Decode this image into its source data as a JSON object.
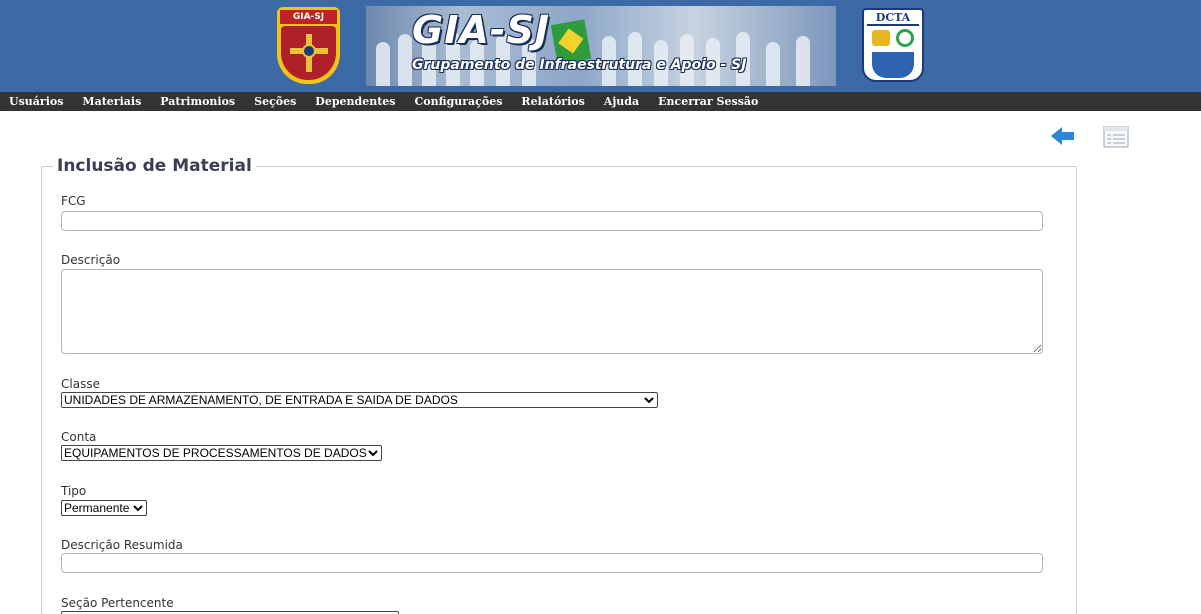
{
  "header": {
    "badge_left_text": "GIA-SJ",
    "title": "GIA-SJ",
    "subtitle": "Grupamento de Infraestrutura e Apoio - SJ",
    "badge_right_text": "DCTA",
    "colors": {
      "banner": "#3b6aa6",
      "menubar": "#333333"
    }
  },
  "menu": {
    "items": [
      "Usuários",
      "Materiais",
      "Patrimonios",
      "Seções",
      "Dependentes",
      "Configurações",
      "Relatórios",
      "Ajuda",
      "Encerrar Sessão"
    ]
  },
  "toolbar": {
    "back_icon": "arrow-left-icon",
    "list_icon": "list-icon"
  },
  "form": {
    "legend": "Inclusão de Material",
    "fcg": {
      "label": "FCG",
      "value": ""
    },
    "descricao": {
      "label": "Descrição",
      "value": ""
    },
    "classe": {
      "label": "Classe",
      "selected": "UNIDADES DE ARMAZENAMENTO, DE ENTRADA E SAIDA DE DADOS"
    },
    "conta": {
      "label": "Conta",
      "selected": "EQUIPAMENTOS DE PROCESSAMENTOS DE DADOS"
    },
    "tipo": {
      "label": "Tipo",
      "selected": "Permanente"
    },
    "descricao_resumida": {
      "label": "Descrição Resumida",
      "value": ""
    },
    "secao_pertencente": {
      "label": "Seção Pertencente"
    }
  }
}
